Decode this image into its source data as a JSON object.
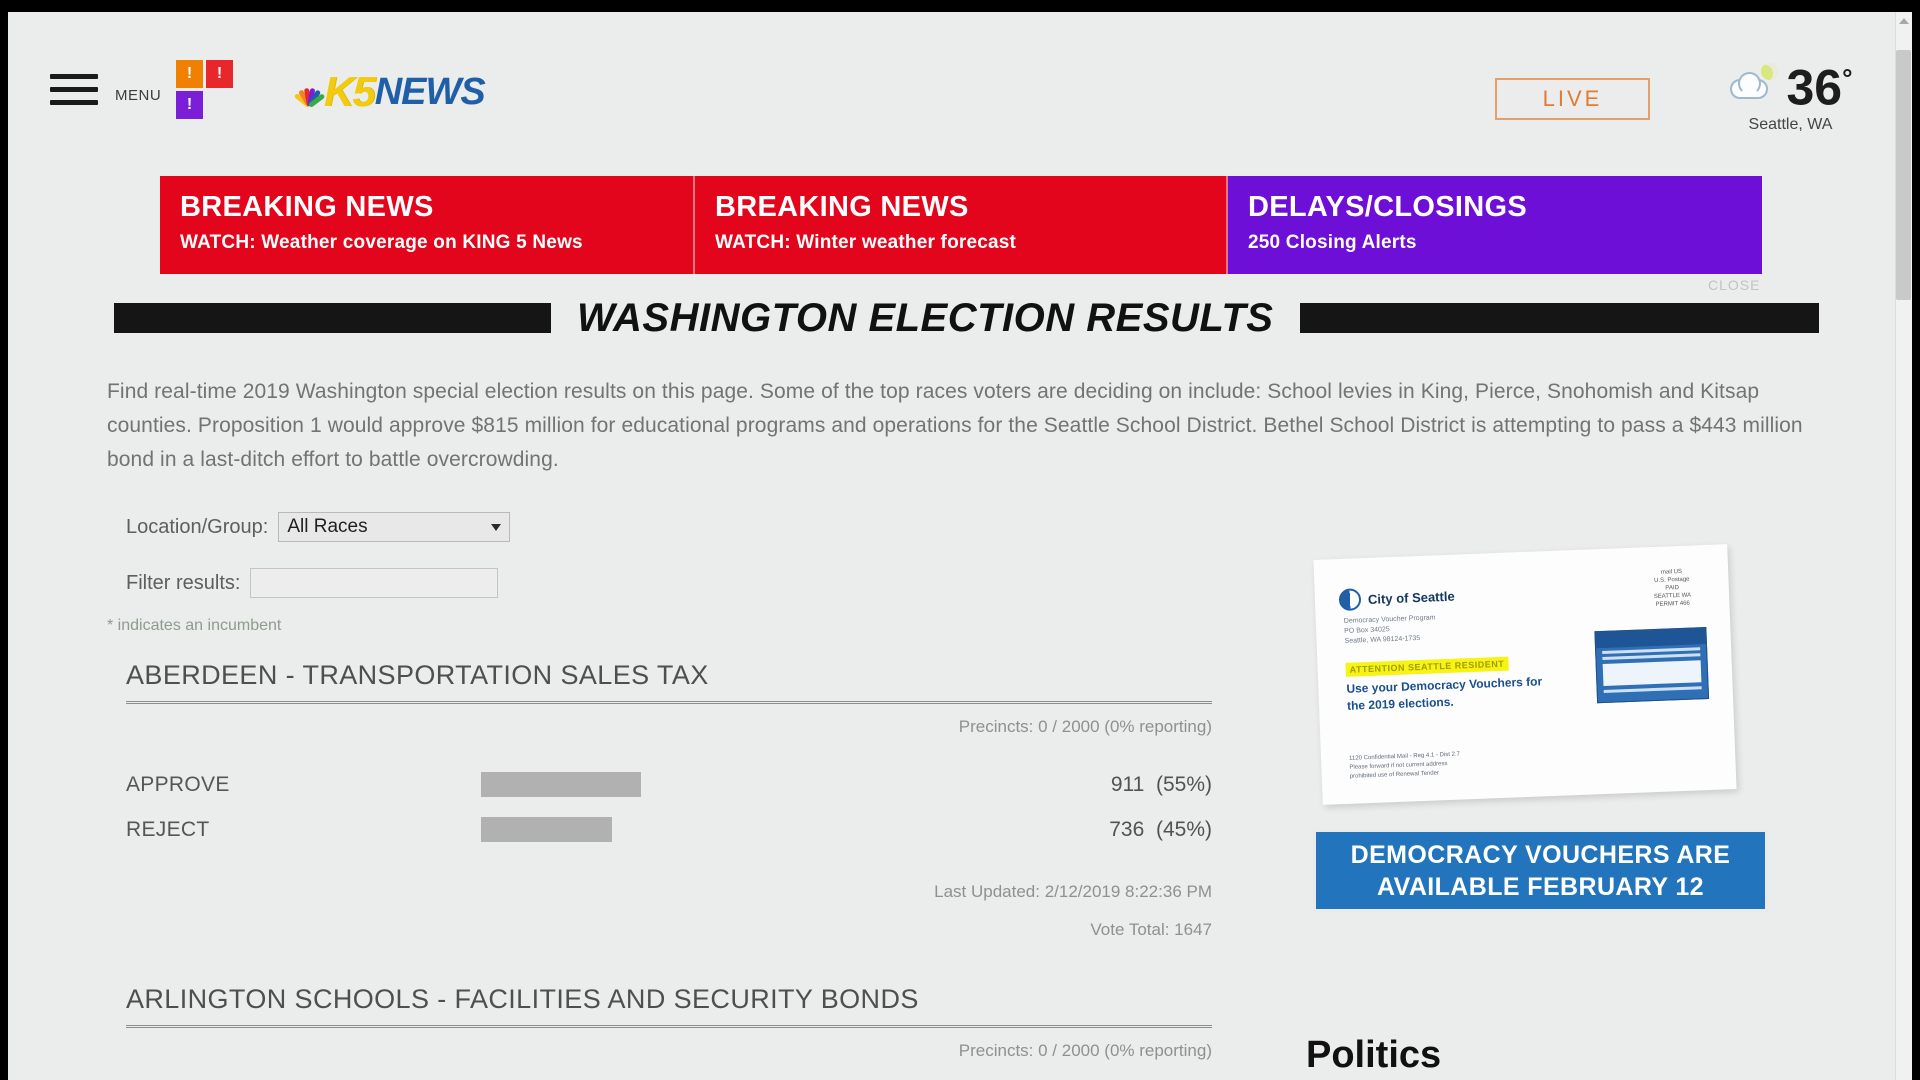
{
  "header": {
    "menu_label": "MENU",
    "alert_tiles": [
      {
        "name": "weather-alert-tile",
        "color": "#f08000",
        "glyph": "!"
      },
      {
        "name": "severe-alert-tile",
        "color": "#e8272c",
        "glyph": "!"
      },
      {
        "name": "closings-alert-tile",
        "color": "#7a1ed8",
        "glyph": "!"
      }
    ],
    "logo_primary": "K5",
    "logo_secondary": "NEWS",
    "live_label": "LIVE",
    "weather": {
      "temperature": "36",
      "degree": "°",
      "city": "Seattle, WA",
      "icon": "partly-cloudy-night-icon"
    }
  },
  "alerts": {
    "close_label": "CLOSE",
    "items": [
      {
        "kind": "breaking",
        "title": "BREAKING NEWS",
        "subtitle": "WATCH: Weather coverage on KING 5 News",
        "color": "#e3051b"
      },
      {
        "kind": "breaking",
        "title": "BREAKING NEWS",
        "subtitle": "WATCH: Winter weather forecast",
        "color": "#e3051b"
      },
      {
        "kind": "closings",
        "title": "DELAYS/CLOSINGS",
        "subtitle": "250 Closing Alerts",
        "color": "#6d0fd6"
      }
    ]
  },
  "page": {
    "title": "WASHINGTON ELECTION RESULTS",
    "intro": "Find real-time 2019 Washington special election results on this page. Some of the top races voters are deciding on include: School levies in King, Pierce, Snohomish and Kitsap counties. Proposition 1 would approve $815 million for educational programs and operations for the Seattle School District. Bethel School District is attempting to pass a $443 million bond in a last-ditch effort to battle overcrowding."
  },
  "filters": {
    "location_label": "Location/Group:",
    "location_value": "All Races",
    "location_options": [
      "All Races"
    ],
    "filter_label": "Filter results:",
    "filter_value": "",
    "filter_placeholder": "",
    "incumbent_note": "* indicates an incumbent"
  },
  "races": [
    {
      "heading": "ABERDEEN - TRANSPORTATION SALES TAX",
      "precincts": "Precincts: 0 / 2000 (0% reporting)",
      "candidates": [
        {
          "name": "APPROVE",
          "votes": "911",
          "percent": "(55%)",
          "bar_pct": 55
        },
        {
          "name": "REJECT",
          "votes": "736",
          "percent": "(45%)",
          "bar_pct": 45
        }
      ],
      "last_updated": "Last Updated: 2/12/2019 8:22:36 PM",
      "vote_total": "Vote Total: 1647"
    },
    {
      "heading": "ARLINGTON SCHOOLS - FACILITIES AND SECURITY BONDS",
      "precincts": "Precincts: 0 / 2000 (0% reporting)",
      "candidates": [],
      "last_updated": "",
      "vote_total": ""
    }
  ],
  "right_rail": {
    "ad": {
      "seal_text": "City of Seattle",
      "address": "Democracy Voucher Program\nPO Box 34025\nSeattle, WA 98124-1735",
      "highlight": "ATTENTION SEATTLE RESIDENT",
      "body": "Use your Democracy Vouchers for the 2019 elections.",
      "fine_print": "1120 Confidential Mail - Reg 4.1 - Dist 2.7\nPlease forward if not current address\nprohibited use of Renewal Tender",
      "stamp": "mail US\nU.S. Postage\nPAID\nSEATTLE WA\nPERMIT 466"
    },
    "banner_line1": "DEMOCRACY VOUCHERS ARE",
    "banner_line2": "AVAILABLE FEBRUARY 12",
    "section_label": "Politics"
  }
}
